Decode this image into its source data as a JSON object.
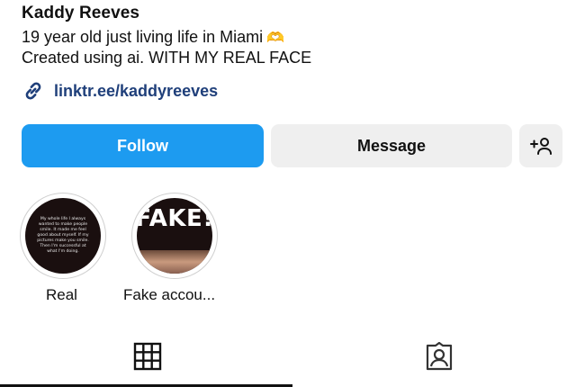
{
  "profile": {
    "name": "Kaddy Reeves",
    "bio_line1": "19 year old just living life in Miami",
    "bio_emoji": "🫶",
    "bio_line2": "Created using ai. WITH MY REAL FACE",
    "link": "linktr.ee/kaddyreeves"
  },
  "actions": {
    "follow_label": "Follow",
    "message_label": "Message",
    "add_user_icon": "add-person-icon"
  },
  "highlights": [
    {
      "label": "Real",
      "preview_text": "My whole life I always wanted to make people smile. It made me feel good about myself. If my pictures make you smile. Then I'm successful at what I'm doing."
    },
    {
      "label": "Fake accou...",
      "preview_text": "FAKE!"
    }
  ],
  "tabs": [
    {
      "icon": "grid-icon",
      "active": true
    },
    {
      "icon": "tagged-icon",
      "active": false
    }
  ],
  "colors": {
    "follow_bg": "#1d9bf0",
    "button_bg": "#efefef",
    "link_color": "#1f3f7a"
  }
}
